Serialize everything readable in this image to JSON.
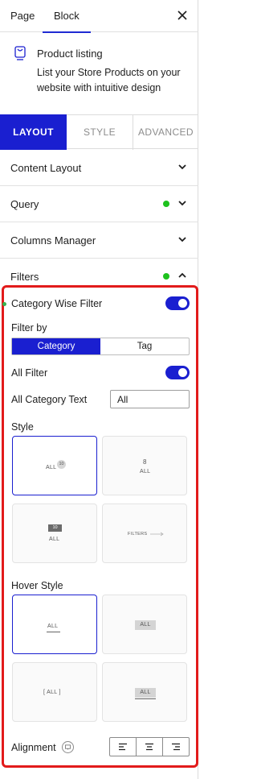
{
  "header": {
    "tabs": [
      {
        "label": "Page"
      },
      {
        "label": "Block"
      }
    ],
    "close_glyph": "✕"
  },
  "block": {
    "title": "Product listing",
    "description": "List your Store Products on your website with intuitive design"
  },
  "layout_tabs": [
    {
      "label": "LAYOUT"
    },
    {
      "label": "STYLE"
    },
    {
      "label": "ADVANCED"
    }
  ],
  "accordion": [
    {
      "label": "Content Layout"
    },
    {
      "label": "Query"
    },
    {
      "label": "Columns Manager"
    },
    {
      "label": "Filters"
    }
  ],
  "filters": {
    "category_wise_filter": "Category Wise Filter",
    "filter_by_label": "Filter by",
    "filter_by_options": [
      "Category",
      "Tag"
    ],
    "all_filter_label": "All Filter",
    "all_category_text_label": "All Category Text",
    "all_category_text_value": "All",
    "style_label": "Style",
    "style_previews": {
      "badge_all": "ALL",
      "badge_count": "10",
      "count_top": "8",
      "count_all": "ALL",
      "box_count": "10",
      "box_all": "ALL",
      "filters_text": "FILTERS"
    },
    "hover_style_label": "Hover Style",
    "hover_previews": [
      "ALL",
      "ALL",
      "[ ALL ]",
      "ALL"
    ],
    "alignment_label": "Alignment"
  },
  "colors": {
    "accent": "#1a1fd0",
    "frame": "#e21b1b",
    "status_green": "#1ec21e"
  }
}
